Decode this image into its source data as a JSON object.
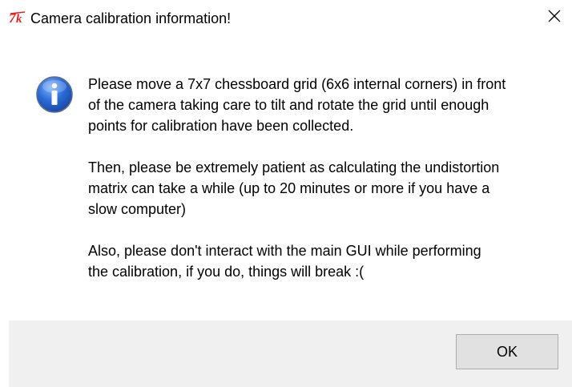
{
  "window": {
    "title": "Camera calibration information!",
    "app_icon": "tk-feather-icon",
    "close_icon": "close-icon"
  },
  "message": {
    "icon": "info-icon",
    "paragraphs": [
      "Please move a 7x7 chessboard grid (6x6 internal corners) in front\nof the camera taking care to tilt and rotate the grid until enough\npoints for calibration have been collected.",
      "Then, please be extremely patient as calculating the undistortion\nmatrix can take a while (up to 20 minutes or more if you have a\nslow computer)",
      "Also, please don't interact with the main GUI while performing\nthe calibration, if you do, things will break :("
    ]
  },
  "buttons": {
    "ok_label": "OK"
  },
  "colors": {
    "footer_background": "#f0f0f0",
    "button_background": "#e1e1e1",
    "button_border": "#adadad",
    "info_icon_blue": "#2a6bd6",
    "tk_icon_red": "#e8211f"
  }
}
